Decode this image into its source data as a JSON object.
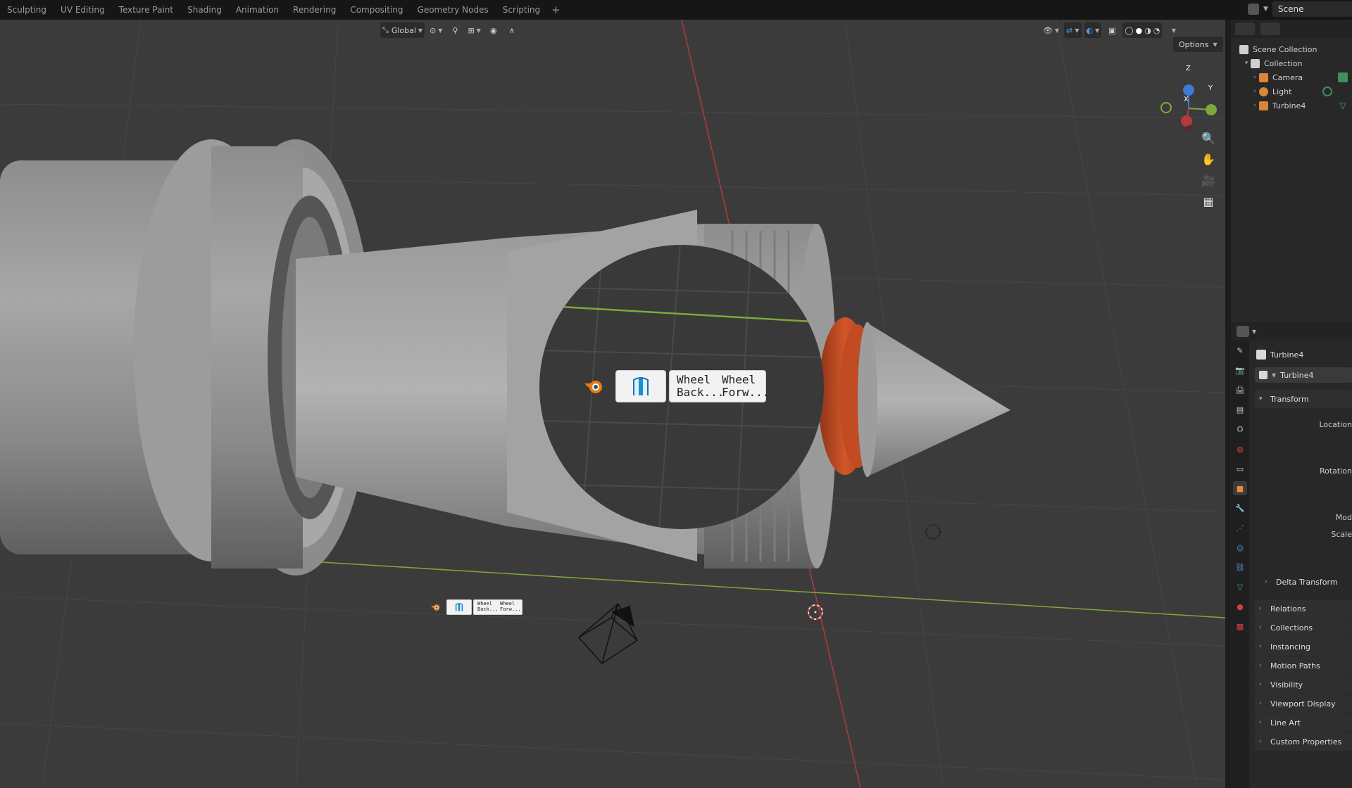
{
  "workspaces": [
    "Sculpting",
    "UV Editing",
    "Texture Paint",
    "Shading",
    "Animation",
    "Rendering",
    "Compositing",
    "Geometry Nodes",
    "Scripting",
    "+"
  ],
  "scene": {
    "name": "Scene"
  },
  "viewport": {
    "orientation": "Global",
    "options_label": "Options",
    "gizmo": {
      "x_label": "X",
      "y_label": "Y",
      "z_label": "Z"
    }
  },
  "addon_panel": {
    "label_1": "Wheel\nBack...",
    "label_2": "Wheel\nForw...",
    "label_1_line1": "Wheel",
    "label_1_line2": "Back...",
    "label_2_line1": "Wheel",
    "label_2_line2": "Forw...",
    "small_label_1_line1": "Wheel",
    "small_label_1_line2": "Back...",
    "small_label_2_line1": "Wheel",
    "small_label_2_line2": "Forw..."
  },
  "outliner": {
    "scene_collection": "Scene Collection",
    "collection": "Collection",
    "items": [
      {
        "label": "Camera",
        "icon": "camera-icon",
        "color": "#d9853b"
      },
      {
        "label": "Light",
        "icon": "light-icon",
        "color": "#d9853b"
      },
      {
        "label": "Turbine4",
        "icon": "mesh-object-icon",
        "color": "#d9853b"
      }
    ]
  },
  "properties": {
    "object_name": "Turbine4",
    "object_field": "Turbine4",
    "transform_label": "Transform",
    "location_label": "Location",
    "rotation_label": "Rotation",
    "mode_label": "Mod",
    "scale_label": "Scale",
    "delta_transform": "Delta Transform",
    "sections": [
      "Relations",
      "Collections",
      "Instancing",
      "Motion Paths",
      "Visibility",
      "Viewport Display",
      "Line Art",
      "Custom Properties"
    ]
  },
  "colors": {
    "viewport_bg": "#3b3b3b",
    "accent_orange": "#d2562a",
    "x_axis": "#b5383e",
    "y_axis": "#7fa83a",
    "z_axis": "#3d7bd6"
  }
}
